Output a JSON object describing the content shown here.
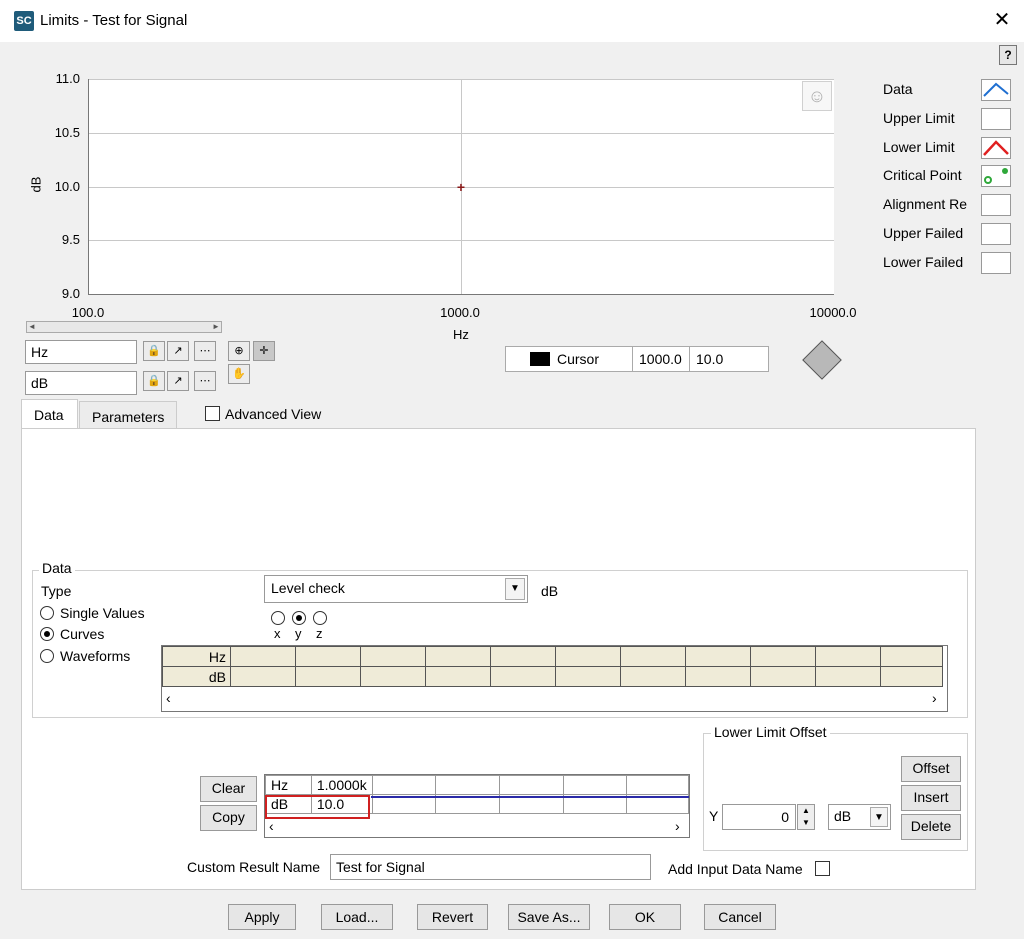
{
  "window": {
    "title": "Limits  - Test for Signal",
    "app_icon": "SC",
    "close": "✕",
    "help": "?"
  },
  "graph": {
    "y_label": "dB",
    "x_label": "Hz",
    "y_ticks": [
      "11.0",
      "10.5",
      "10.0",
      "9.5",
      "9.0"
    ],
    "x_ticks": [
      "100.0",
      "1000.0",
      "10000.0"
    ],
    "x_scale": "log",
    "point": {
      "x": 1000.0,
      "y": 10.0
    },
    "marker_color": "#8b1a1a"
  },
  "legend": [
    {
      "label": "Data",
      "icon": "data-line-icon"
    },
    {
      "label": "Upper Limit",
      "icon": ""
    },
    {
      "label": "Lower Limit",
      "icon": "lower-limit-line-icon"
    },
    {
      "label": "Critical Point",
      "icon": "critical-point-icon"
    },
    {
      "label": "Alignment Re",
      "icon": ""
    },
    {
      "label": "Upper Failed",
      "icon": ""
    },
    {
      "label": "Lower Failed",
      "icon": ""
    }
  ],
  "axes_controls": {
    "x_name": "Hz",
    "y_name": "dB"
  },
  "cursor": {
    "name": "Cursor",
    "x": "1000.0",
    "y": "10.0"
  },
  "tabs": [
    {
      "label": "Data"
    },
    {
      "label": "Parameters"
    }
  ],
  "advanced_view": {
    "label": "Advanced View",
    "checked": false
  },
  "data_group": {
    "title": "Data",
    "type_label": "Type",
    "type_value": "Level check",
    "unit": "dB",
    "radio_options": [
      "Single Values",
      "Curves",
      "Waveforms"
    ],
    "radio_selected": "Curves",
    "axis_radios": [
      "x",
      "y",
      "z"
    ],
    "axis_selected": "y",
    "table_rows": [
      "Hz",
      "dB"
    ]
  },
  "result_table": {
    "clear_label": "Clear",
    "copy_label": "Copy",
    "rows": [
      {
        "header": "Hz",
        "value": "1.0000k"
      },
      {
        "header": "dB",
        "value": "10.0"
      }
    ]
  },
  "offset_group": {
    "title": "Lower Limit Offset",
    "y_label": "Y",
    "y_value": "0",
    "unit": "dB",
    "offset_label": "Offset",
    "insert_label": "Insert",
    "delete_label": "Delete"
  },
  "custom_result": {
    "label": "Custom Result Name",
    "value": "Test for Signal"
  },
  "add_input": {
    "label": "Add Input Data Name",
    "checked": false
  },
  "buttons": {
    "apply": "Apply",
    "load": "Load...",
    "revert": "Revert",
    "save_as": "Save As...",
    "ok": "OK",
    "cancel": "Cancel"
  },
  "colors": {
    "data_line": "#1f6fd1",
    "lower_limit": "#e02020",
    "critical_point": "#2fa83a",
    "highlight": "#d02020",
    "curve": "#2a2aa8"
  }
}
